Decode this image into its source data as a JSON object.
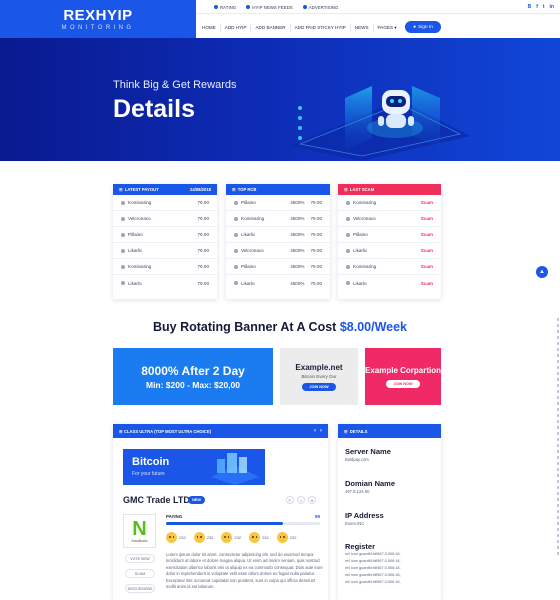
{
  "header": {
    "logo_main": "REXHYIP",
    "logo_sub": "MONITORING",
    "top_links": [
      "RATING",
      "HYIP NEWS FEEDS",
      "ADVERTISING"
    ],
    "socials": [
      "B",
      "f",
      "t",
      "in"
    ],
    "nav": [
      "HOME",
      "ADD HYIP",
      "ADD BANNER",
      "ADD PAID STICKY HYIP",
      "NEWS",
      "PAGES ▾"
    ],
    "signin": "Sign In"
  },
  "hero": {
    "subtitle": "Think Big & Get Rewards",
    "title": "Details"
  },
  "latest_payout": {
    "title": "LATEST PAYOUT",
    "date": "24/08/2018",
    "rows": [
      {
        "name": "Kominaring",
        "amount": "79.00"
      },
      {
        "name": "Velcronaco",
        "amount": "79.00"
      },
      {
        "name": "Pillaino",
        "amount": "79.00"
      },
      {
        "name": "Likarlic",
        "amount": "79.00"
      },
      {
        "name": "Kominaring",
        "amount": "79.00"
      },
      {
        "name": "Likarlo",
        "amount": "79.00"
      }
    ]
  },
  "top_rcb": {
    "title": "TOP RCB",
    "rows": [
      {
        "name": "Pillaino",
        "pct": "4500%",
        "amount": "79.00"
      },
      {
        "name": "Kominaring",
        "pct": "4500%",
        "amount": "79.00"
      },
      {
        "name": "Likarlic",
        "pct": "4500%",
        "amount": "79.00"
      },
      {
        "name": "Velcronaco",
        "pct": "4500%",
        "amount": "79.00"
      },
      {
        "name": "Pillaino",
        "pct": "4500%",
        "amount": "79.00"
      },
      {
        "name": "Likarlo",
        "pct": "4500%",
        "amount": "79.00"
      }
    ]
  },
  "last_scam": {
    "title": "LAST SCAM",
    "rows": [
      {
        "name": "Kominaring",
        "status": "Scam"
      },
      {
        "name": "Velcronaco",
        "status": "Scam"
      },
      {
        "name": "Pillaino",
        "status": "Scam"
      },
      {
        "name": "Likarlic",
        "status": "Scam"
      },
      {
        "name": "Kominaring",
        "status": "Scam"
      },
      {
        "name": "Likarlo",
        "status": "Scam"
      }
    ]
  },
  "banner_section": {
    "heading": "Buy Rotating Banner At A Cost ",
    "price": "$8.00/Week"
  },
  "ads": {
    "ad1_line1": "8000% After 2 Day",
    "ad1_line2": "Min: $200 - Max: $20,00",
    "ad2_title": "Example.net",
    "ad2_sub": "Bitcoin Every Our",
    "ad2_btn": "JOIN NOW",
    "ad3_title": "Example Corpartion",
    "ad3_btn": "JOIN NOW"
  },
  "listing": {
    "header": "CLASS ULTRA (TOP MOST ULTRA CHOICE)",
    "bitcoin_title": "Bitcoin",
    "bitcoin_sub": "For your future",
    "company": "GMC Trade LTD.",
    "new_tag": "NEW",
    "logo_letter": "N",
    "logo_brand": "NovaBucks",
    "buttons": [
      "VOTE NOW",
      "SCAM",
      "DISCUSSIONS"
    ],
    "paying_label": "PAYING",
    "paying_pct": "99",
    "paying_progress": 0.76,
    "votes": [
      "232",
      "232",
      "232",
      "232",
      "232"
    ],
    "lorem": "Lorem ipsum dolor sit amet, consectetur adipisicing elit, sed do eiusmod tempor incididunt ut labore et dolore magna aliqua. Ut enim ad minim veniam, quis nostrud exercitation ullamco laboris nisi ut aliquip ex ea commodo consequat. Duis aute irure dolor in reprehenderit in voluptate velit esse cillum dolore eu fugiat nulla pariatur. Excepteur sint occaecat cupidatat non proident, sunt in culpa qui officia deserunt mollit anim id est laborum."
  },
  "details": {
    "header": "DETAILS",
    "server_label": "Server Name",
    "server_val": "Boldpay.com",
    "domain_label": "Domian Name",
    "domain_val": "467.9.124.90",
    "ip_label": "IP Address",
    "ip_val": "Enem.INC",
    "register_label": "Register",
    "register_lines": [
      "m/l icon guardf4:fdf567:3.506:18,",
      "m/l icon guardf4:fdf567:3.506:18,",
      "m/l icon guardf4:fdf567:3.506:18,",
      "m/l icon guardf4:fdf567:3.506:18,",
      "m/l icon guardf4:fdf567:3.506:18,"
    ]
  },
  "colors": {
    "primary": "#1a56e8",
    "scam": "#ef2f5a",
    "ad_pink": "#f02a66"
  }
}
